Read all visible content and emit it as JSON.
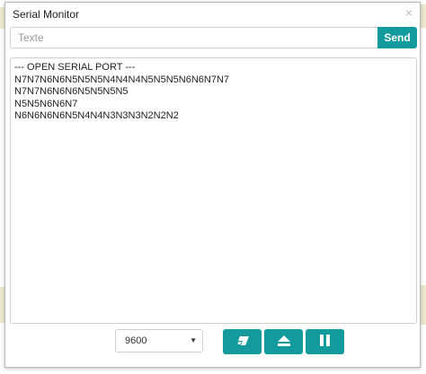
{
  "dialog": {
    "title": "Serial Monitor",
    "close_glyph": "×"
  },
  "send_bar": {
    "input_value": "",
    "input_placeholder": "Texte",
    "send_label": "Send"
  },
  "console": {
    "lines": [
      "--- OPEN SERIAL PORT ---",
      "N7N7N6N6N5N5N5N4N4N4N5N5N5N6N6N7N7",
      "N7N7N6N6N6N5N5N5N5",
      "N5N5N6N6N7",
      "N6N6N6N6N5N4N4N3N3N3N2N2N2"
    ]
  },
  "footer": {
    "baud_rate": "9600",
    "buttons": [
      {
        "icon": "eraser-icon",
        "action": "clear"
      },
      {
        "icon": "eject-icon",
        "action": "disconnect"
      },
      {
        "icon": "pause-icon",
        "action": "pause"
      }
    ]
  },
  "colors": {
    "accent": "#129a9d"
  }
}
